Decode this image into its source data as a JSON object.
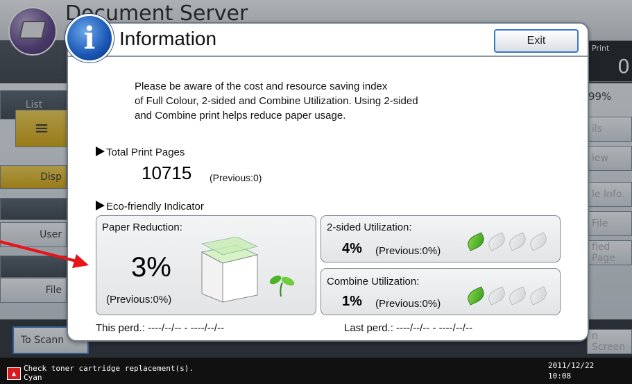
{
  "background": {
    "screen_title": "Document Server",
    "left_buttons": [
      "List",
      "Disp",
      "User",
      "File",
      "To Scann"
    ],
    "right_items": [
      "Print",
      "0",
      "99%",
      "ils",
      "iew",
      "le Info.",
      "File",
      "fied Page",
      "n Screen"
    ]
  },
  "status_bar": {
    "message_line1": "Check toner cartridge replacement(s).",
    "message_line2": "Cyan",
    "date": "2011/12/22",
    "time": "10:08"
  },
  "dialog": {
    "title": "Information",
    "exit_label": "Exit",
    "message": "Please be aware of the cost and resource saving index\nof Full Colour, 2-sided and Combine Utilization. Using 2-sided\nand Combine print helps reduce paper usage.",
    "total_print_pages": {
      "heading": "Total Print Pages",
      "value": "10715",
      "previous": "(Previous:0)"
    },
    "eco": {
      "heading": "Eco-friendly Indicator",
      "paper_reduction": {
        "label": "Paper Reduction:",
        "value": "3%",
        "previous": "(Previous:0%)"
      },
      "two_sided": {
        "label": "2-sided Utilization:",
        "value": "4%",
        "previous": "(Previous:0%)",
        "leaves_on": 1,
        "leaves_total": 4
      },
      "combine": {
        "label": "Combine Utilization:",
        "value": "1%",
        "previous": "(Previous:0%)",
        "leaves_on": 1,
        "leaves_total": 4
      }
    },
    "this_period": "This perd.:  ----/--/-- - ----/--/--",
    "last_period": "Last perd.:  ----/--/-- - ----/--/--"
  },
  "colors": {
    "arrow": "#e8141a",
    "exit_border": "#3a78c8",
    "leaf_on": "#3a9e20"
  }
}
